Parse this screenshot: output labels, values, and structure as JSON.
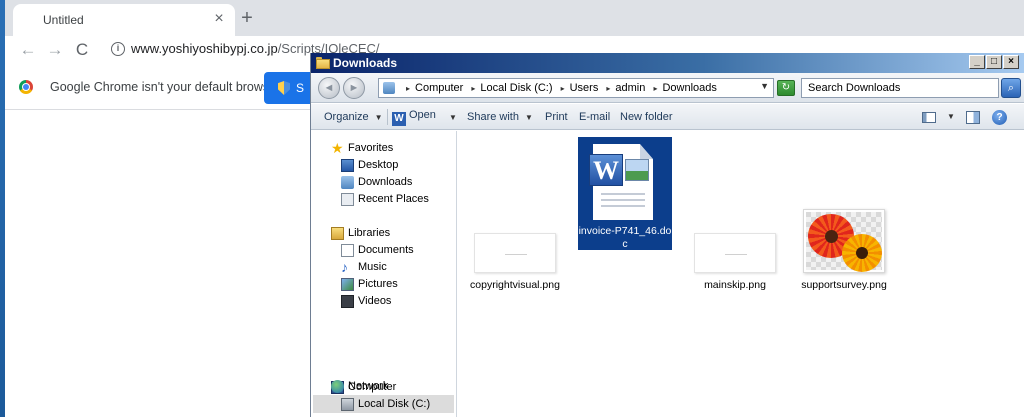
{
  "browser": {
    "tab_title": "Untitled",
    "tab_close": "×",
    "new_tab": "+",
    "back": "←",
    "forward": "→",
    "reload": "C",
    "info": "i",
    "url_host": "www.yoshiyoshibypj.co.jp",
    "url_path": "/Scripts/IOleCEC/",
    "infobar_text": "Google Chrome isn't your default browser",
    "set_default_label": "S"
  },
  "explorer": {
    "title": "Downloads",
    "window_buttons": {
      "minimize": "_",
      "maximize": "□",
      "close": "×"
    },
    "back": "◄",
    "forward": "►",
    "breadcrumb": [
      "Computer",
      "Local Disk (C:)",
      "Users",
      "admin",
      "Downloads"
    ],
    "breadcrumb_sep": "▸",
    "dropdown_glyph": "▼",
    "refresh": "↻",
    "search_placeholder": "Search Downloads",
    "search_icon": "⌕",
    "commands": {
      "organize": "Organize",
      "open_icon": "W",
      "open": "Open",
      "share_with": "Share with",
      "print": "Print",
      "email": "E-mail",
      "new_folder": "New folder",
      "caret": "▼",
      "help": "?"
    },
    "nav": {
      "favorites": "Favorites",
      "desktop": "Desktop",
      "downloads": "Downloads",
      "recent_places": "Recent Places",
      "libraries": "Libraries",
      "documents": "Documents",
      "music": "Music",
      "pictures": "Pictures",
      "videos": "Videos",
      "computer": "Computer",
      "local_disk": "Local Disk (C:)",
      "network": "Network",
      "selected": "Local Disk (C:)"
    },
    "files": [
      {
        "name": "copyrightvisual.png",
        "type": "png-blank"
      },
      {
        "name": "invoice-P741_46.doc",
        "name_line1": "invoice-P741_46.do",
        "name_line2": "c",
        "type": "word-doc",
        "selected": true
      },
      {
        "name": "mainskip.png",
        "type": "png-blank"
      },
      {
        "name": "supportsurvey.png",
        "type": "png-flowers"
      }
    ],
    "word_letter": "W",
    "icons": {
      "favorites": "star-icon",
      "desktop": "desktop-icon",
      "downloads": "downloads-folder-icon",
      "recent": "recent-places-icon",
      "libraries": "libraries-icon",
      "documents": "documents-icon",
      "music": "music-note-icon",
      "pictures": "pictures-icon",
      "videos": "videos-icon",
      "computer": "computer-icon",
      "disk": "local-disk-icon",
      "network": "network-icon"
    },
    "colors": {
      "selection": "#0c3e8c",
      "titlebar": "#0a246a",
      "chrome_button": "#1a73e8"
    }
  },
  "glyphs": {
    "star": "★",
    "note": "♪"
  }
}
